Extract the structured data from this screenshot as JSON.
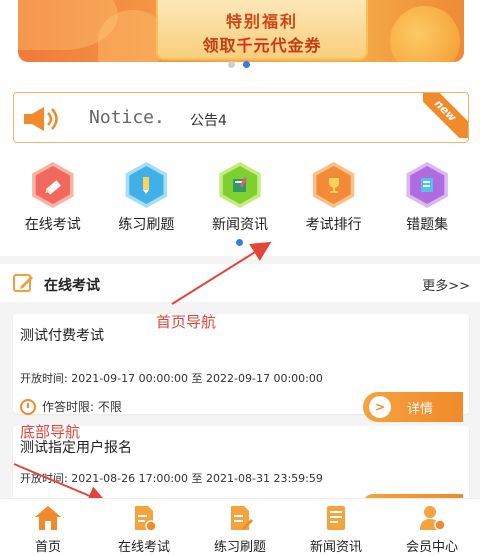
{
  "banner": {
    "line1": "特别福利",
    "line2_prefix": "领取",
    "line2_highlight": "千元",
    "line2_suffix": "代金券",
    "dots": [
      false,
      true
    ]
  },
  "notice": {
    "title": "Notice.",
    "text": "公告4",
    "ribbon": "new"
  },
  "categories": [
    {
      "label": "在线考试",
      "icon": "pencil-icon"
    },
    {
      "label": "练习刷题",
      "icon": "pen-icon"
    },
    {
      "label": "新闻资讯",
      "icon": "book-icon"
    },
    {
      "label": "考试排行",
      "icon": "trophy-icon"
    },
    {
      "label": "错题集",
      "icon": "notebook-icon"
    }
  ],
  "section": {
    "title": "在线考试",
    "more": "更多>>"
  },
  "cards": [
    {
      "title": "测试付费考试",
      "time": "开放时间: 2021-09-17 00:00:00 至 2022-09-17 00:00:00",
      "limit": "作答时限: 不限",
      "button": "详情"
    },
    {
      "title": "测试指定用户报名",
      "time": "开放时间: 2021-08-26 17:00:00 至 2021-08-31 23:59:59"
    }
  ],
  "annotations": {
    "home_nav": "首页导航",
    "bottom_nav": "底部导航"
  },
  "nav": [
    {
      "label": "首页",
      "icon": "home-icon"
    },
    {
      "label": "在线考试",
      "icon": "exam-icon"
    },
    {
      "label": "练习刷题",
      "icon": "practice-icon"
    },
    {
      "label": "新闻资讯",
      "icon": "news-icon"
    },
    {
      "label": "会员中心",
      "icon": "member-icon"
    }
  ],
  "colors": {
    "accent": "#f08a2a",
    "indicator": "#2f7fe0",
    "annotation": "#e4453a"
  }
}
